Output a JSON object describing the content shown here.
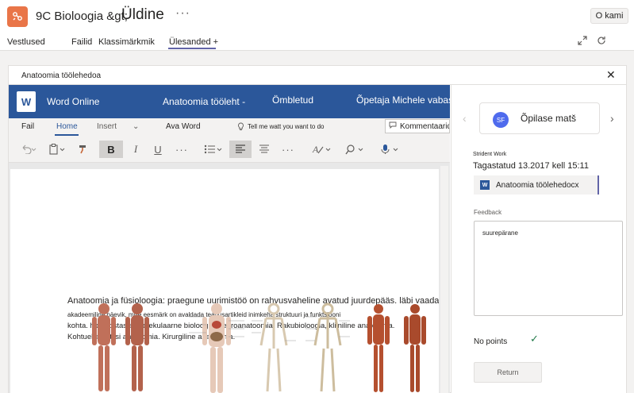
{
  "header": {
    "team": "9C Bioloogia &gt;",
    "channel": "Üldine",
    "more": "···",
    "meet_label": "O kami",
    "tabs": [
      {
        "label": "Vestlused"
      },
      {
        "label": "Failid"
      },
      {
        "label": "Klassimärkmik"
      },
      {
        "label": "Ülesanded +"
      }
    ],
    "colors": {
      "team_logo": "#e97548",
      "accent": "#6264a7"
    }
  },
  "panel": {
    "title": "Anatoomia töölehedoa",
    "close": "✕"
  },
  "word": {
    "app_name": "Word Online",
    "doc_title": "Anatoomia tööleht -",
    "status": "Ömbletud",
    "author": "Õpetaja Michele vabasta",
    "ribbon": {
      "fail": "Fail",
      "home": "Home",
      "insert": "Insert",
      "open_word": "Ava Word",
      "tell_me": "Tell me watt you want to do",
      "comments": "Kommentaarid"
    },
    "brand_color": "#2b579a"
  },
  "document": {
    "lines": [
      "Anatoomia ja füsioloogia: praegune uurimistöö on rahvusvaheline avatud juurdepääs. läbi vaadatud.",
      "akadeemiline päevik, mille eesmärk on avaldada teadusartikleid inimkeha struktuuri ja funktsiooni",
      "kohta. homeostasis, molekulaarne bioloogia, neuroanatoomia. Rakubioloogia, kliiniline anatoomia.",
      "Kohtuekspertiisi anatoomia. Kirurgiline anatoomia."
    ]
  },
  "sidebar": {
    "student_initials": "SF",
    "student_name": "Õpilase matš",
    "student_work_label": "Strident Work",
    "turned_in": "Tagastatud 13.2017 kell 15:11",
    "file_name": "Anatoomia töölehedocx",
    "feedback_label": "Feedback",
    "feedback_text": "suurepärane",
    "points": "No points",
    "return_label": "Return"
  }
}
